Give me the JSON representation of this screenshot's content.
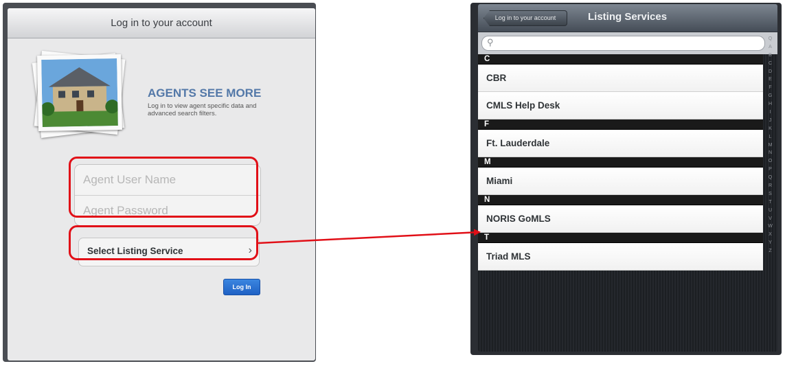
{
  "left": {
    "header_title": "Log in to your account",
    "promo_title": "AGENTS SEE MORE",
    "promo_text": "Log in to view agent specific data and advanced search filters.",
    "username_placeholder": "Agent User Name",
    "password_placeholder": "Agent Password",
    "select_label": "Select Listing Service",
    "select_chevron": "›",
    "login_label": "Log In"
  },
  "right": {
    "back_label": "Log in to your account",
    "title": "Listing Services",
    "search_icon": "⚲",
    "sections": [
      {
        "letter": "C",
        "items": [
          "CBR",
          "CMLS Help Desk"
        ]
      },
      {
        "letter": "F",
        "items": [
          "Ft. Lauderdale"
        ]
      },
      {
        "letter": "M",
        "items": [
          "Miami"
        ]
      },
      {
        "letter": "N",
        "items": [
          "NORIS GoMLS"
        ]
      },
      {
        "letter": "T",
        "items": [
          "Triad MLS"
        ]
      }
    ],
    "index": [
      "Q",
      "A",
      "B",
      "C",
      "D",
      "E",
      "F",
      "G",
      "H",
      "I",
      "J",
      "K",
      "L",
      "M",
      "N",
      "O",
      "P",
      "Q",
      "R",
      "S",
      "T",
      "U",
      "V",
      "W",
      "X",
      "Y",
      "Z"
    ]
  },
  "colors": {
    "highlight": "#e10f17",
    "login_button": "#2a6fd1",
    "promo_title": "#5378a8"
  }
}
